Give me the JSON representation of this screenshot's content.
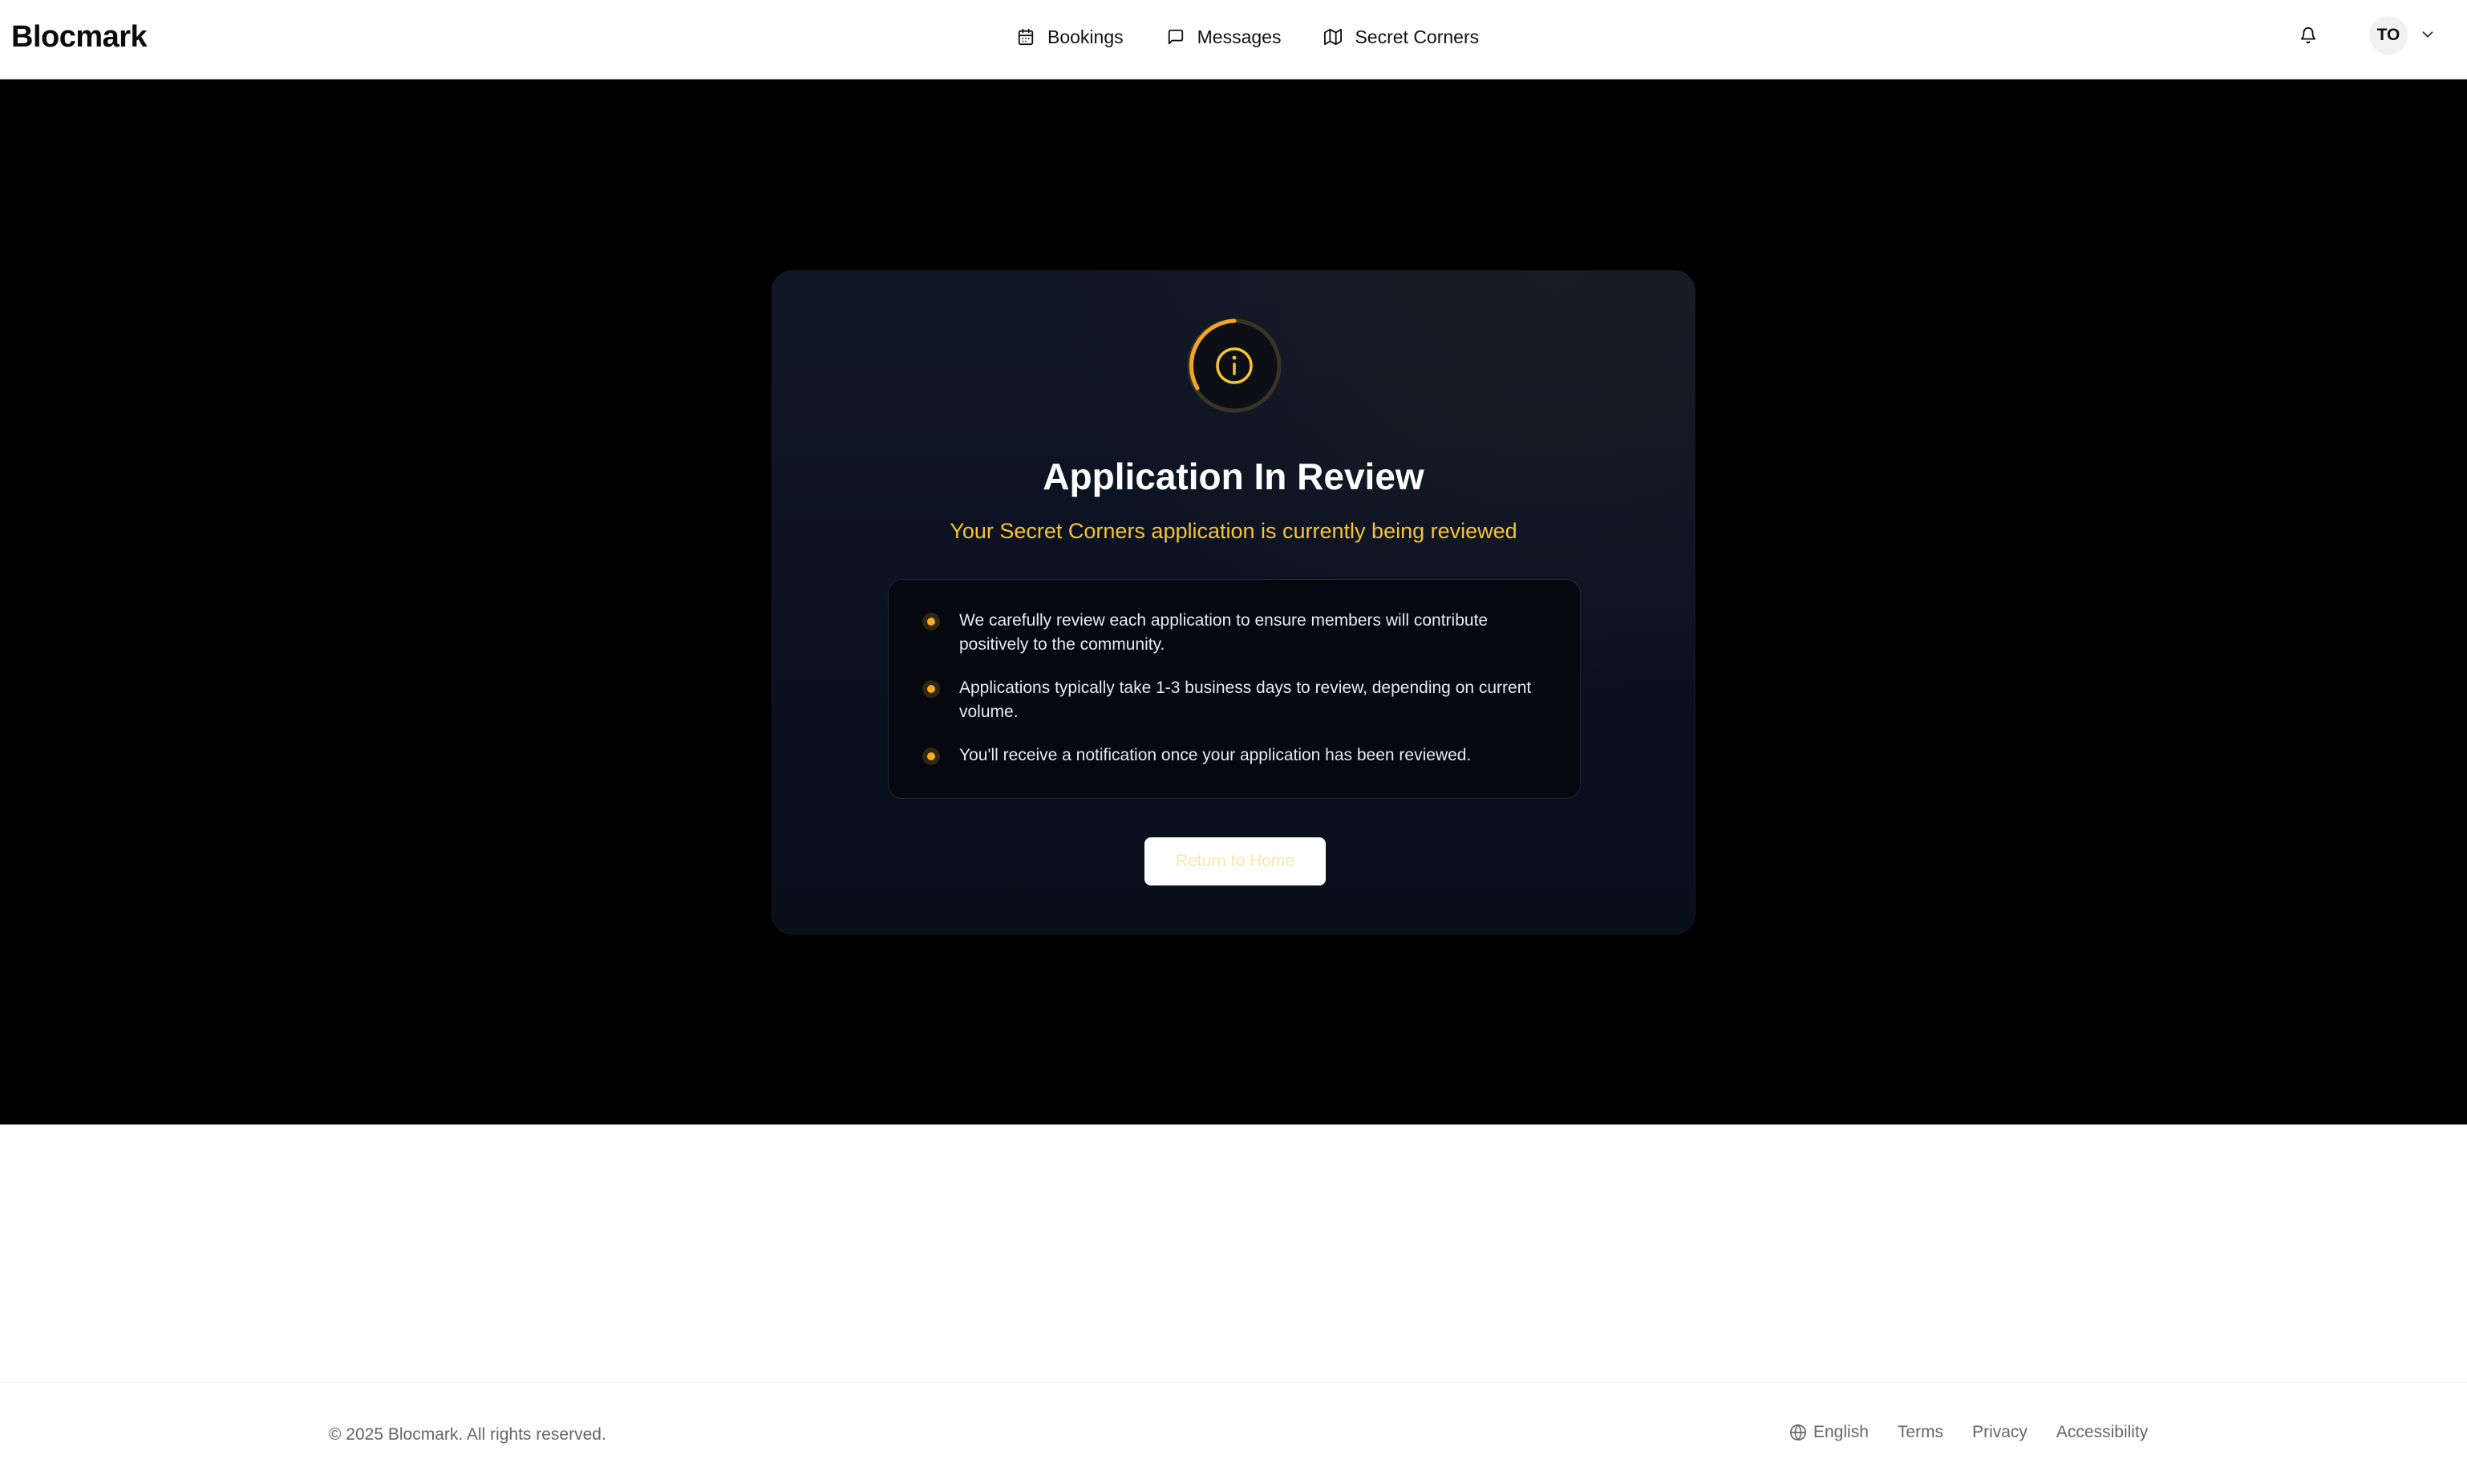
{
  "header": {
    "logo": "Blocmark",
    "nav": [
      {
        "label": "Bookings",
        "icon": "calendar-icon"
      },
      {
        "label": "Messages",
        "icon": "message-icon"
      },
      {
        "label": "Secret Corners",
        "icon": "map-icon"
      }
    ],
    "avatar_initials": "TO"
  },
  "card": {
    "icon": "info-icon",
    "title": "Application In Review",
    "subtitle": "Your Secret Corners application is currently being reviewed",
    "items": [
      "We carefully review each application to ensure members will contribute positively to the community.",
      "Applications typically take 1-3 business days to review, depending on current volume.",
      "You'll receive a notification once your application has been reviewed."
    ],
    "button_label": "Return to Home"
  },
  "footer": {
    "copyright": "© 2025 Blocmark. All rights reserved.",
    "language": "English",
    "links": [
      "Terms",
      "Privacy",
      "Accessibility"
    ]
  },
  "colors": {
    "accent": "#f5ae1e",
    "subtitle": "#f6c431",
    "card_bg": "#0b1120",
    "hero_bg": "#000000"
  }
}
